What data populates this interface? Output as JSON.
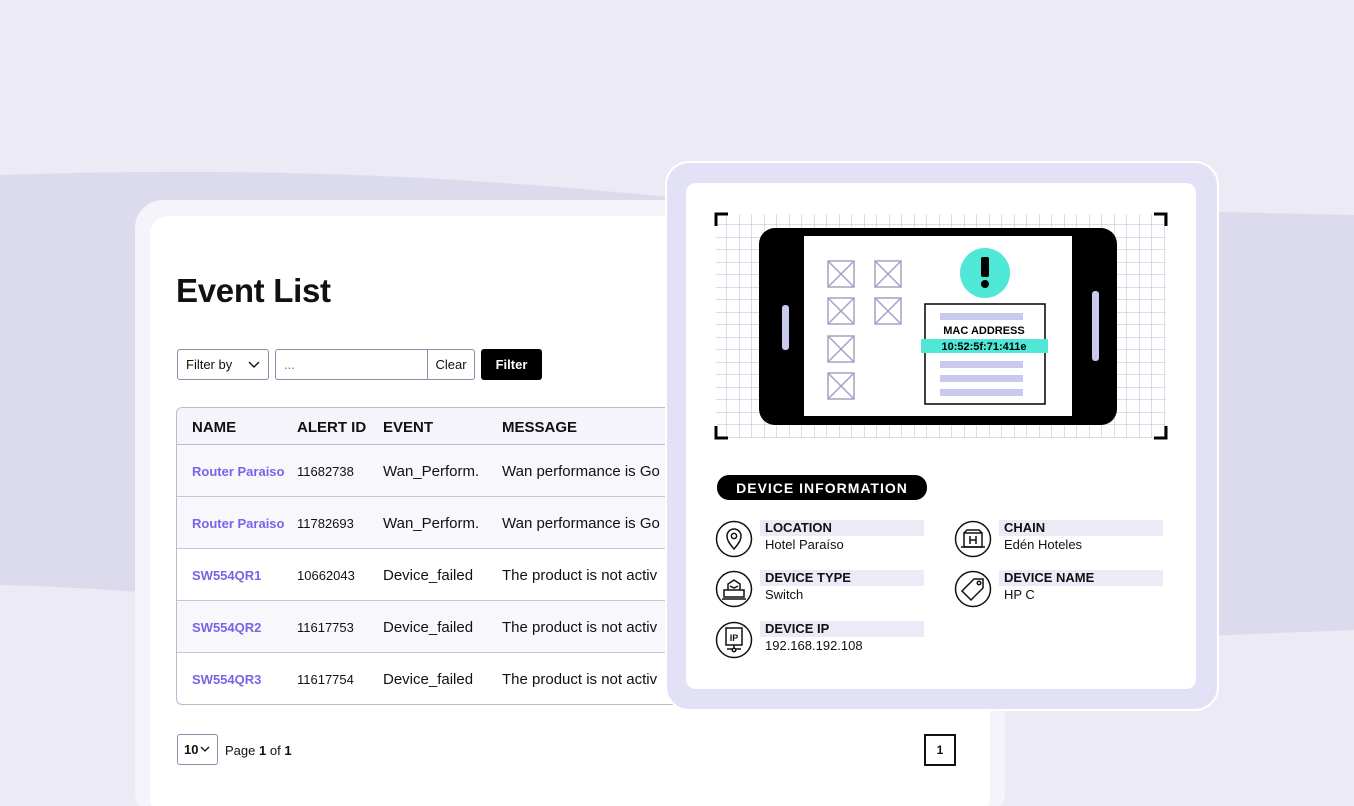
{
  "event_list": {
    "title": "Event List",
    "filter": {
      "select_label": "Filter by",
      "input_placeholder": "...",
      "clear_label": "Clear",
      "filter_label": "Filter"
    },
    "columns": [
      "NAME",
      "ALERT ID",
      "EVENT",
      "MESSAGE"
    ],
    "rows": [
      {
        "name": "Router Paraiso",
        "alert_id": "11682738",
        "event": "Wan_Perform.",
        "message": "Wan performance is Go"
      },
      {
        "name": "Router Paraiso",
        "alert_id": "11782693",
        "event": "Wan_Perform.",
        "message": "Wan performance is Go"
      },
      {
        "name": "SW554QR1",
        "alert_id": "10662043",
        "event": "Device_failed",
        "message": "The product is not activ"
      },
      {
        "name": "SW554QR2",
        "alert_id": "11617753",
        "event": "Device_failed",
        "message": "The product is not activ"
      },
      {
        "name": "SW554QR3",
        "alert_id": "11617754",
        "event": "Device_failed",
        "message": "The product is not activ"
      }
    ],
    "pagination": {
      "page_size": "10",
      "page_word": "Page",
      "current": "1",
      "of_word": "of",
      "total": "1",
      "page_button": "1"
    }
  },
  "device_panel": {
    "illustration": {
      "mac_label": "MAC ADDRESS",
      "mac_value": "10:52:5f:71:411e",
      "alert_icon": "exclamation-icon"
    },
    "section_title": "DEVICE INFORMATION",
    "items": [
      {
        "icon": "location-pin-icon",
        "label": "LOCATION",
        "value": "Hotel Paraíso"
      },
      {
        "icon": "hotel-building-icon",
        "label": "CHAIN",
        "value": "Edén Hoteles"
      },
      {
        "icon": "switch-device-icon",
        "label": "DEVICE TYPE",
        "value": "Switch"
      },
      {
        "icon": "tag-icon",
        "label": "DEVICE NAME",
        "value": "HP C"
      },
      {
        "icon": "ip-icon",
        "label": "DEVICE  IP",
        "value": "192.168.192.108"
      }
    ]
  },
  "colors": {
    "background": "#ecebf5",
    "accent_purple": "#7b63e6",
    "highlight_cyan": "#4fe7d6",
    "panel_lavender": "#e2e1f5"
  }
}
